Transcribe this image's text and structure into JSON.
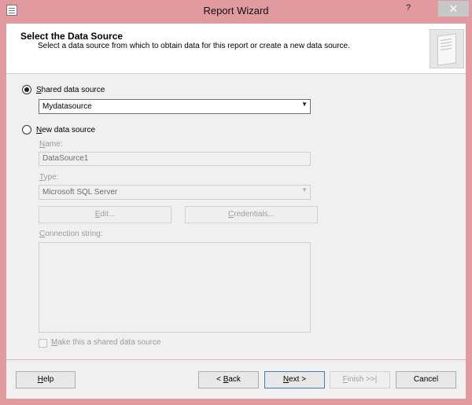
{
  "window": {
    "title": "Report Wizard",
    "help_glyph": "?",
    "close_glyph": "✕"
  },
  "header": {
    "title": "Select the Data Source",
    "subtitle": "Select a data source from which to obtain data for this report or create a new data source."
  },
  "shared": {
    "label_prefix": "",
    "label_underline": "S",
    "label_rest": "hared data source",
    "checked": true,
    "value": "Mydatasource"
  },
  "newsrc": {
    "label_prefix": "",
    "label_underline": "N",
    "label_rest": "ew data source",
    "checked": false,
    "name_label_u": "N",
    "name_label_rest": "ame:",
    "name_value": "DataSource1",
    "type_label_u": "T",
    "type_label_rest": "ype:",
    "type_value": "Microsoft SQL Server",
    "edit_u": "E",
    "edit_rest": "dit...",
    "cred_u": "C",
    "cred_rest": "redentials...",
    "conn_label_u": "C",
    "conn_label_rest": "onnection string:",
    "conn_value": "",
    "shared_check_u": "M",
    "shared_check_rest": "ake this a shared data source"
  },
  "footer": {
    "help_u": "H",
    "help_rest": "elp",
    "back_prefix": "< ",
    "back_u": "B",
    "back_rest": "ack",
    "next_u": "N",
    "next_rest": "ext >",
    "finish_u": "F",
    "finish_rest": "inish >>|",
    "cancel": "Cancel"
  }
}
